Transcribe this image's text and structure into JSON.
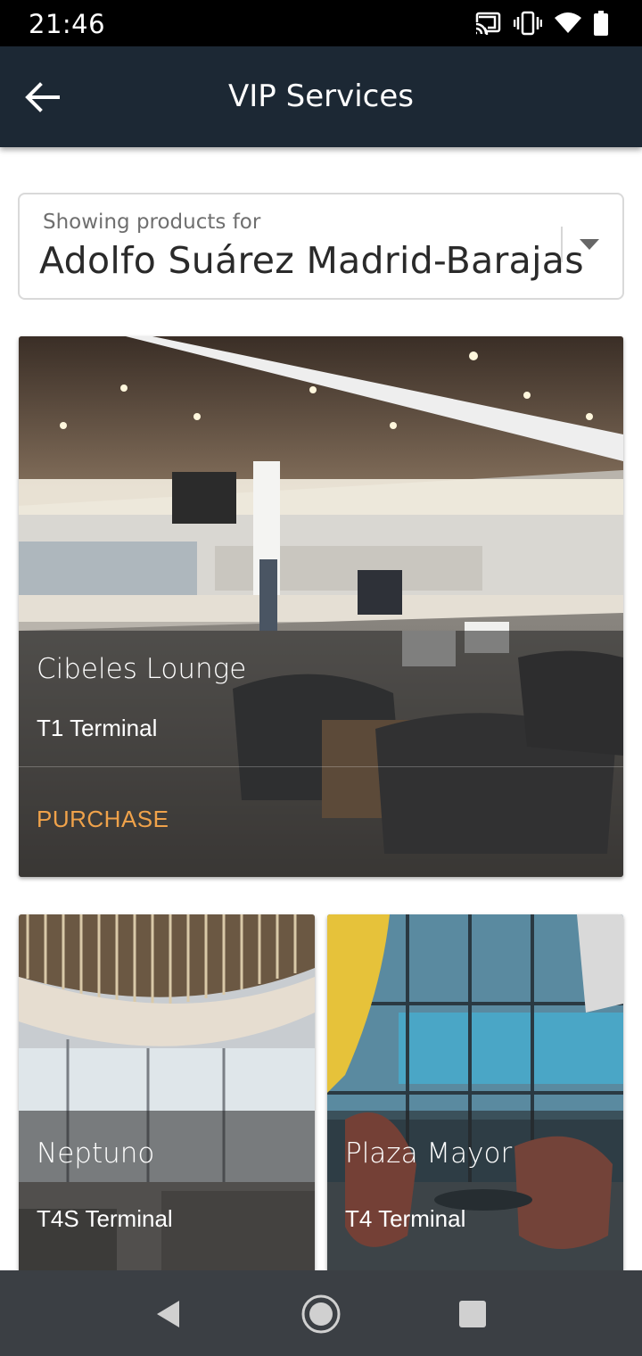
{
  "status_bar": {
    "time": "21:46",
    "icons": [
      "cast-icon",
      "vibrate-icon",
      "wifi-icon",
      "battery-icon"
    ]
  },
  "app_bar": {
    "title": "VIP Services",
    "back_icon": "arrow-left-icon"
  },
  "airport_selector": {
    "label": "Showing products for",
    "value": "Adolfo Suárez Madrid-Barajas"
  },
  "products": [
    {
      "name": "Cibeles Lounge",
      "terminal": "T1 Terminal",
      "action": "PURCHASE"
    },
    {
      "name": "Neptuno",
      "terminal": "T4S Terminal"
    },
    {
      "name": "Plaza Mayor",
      "terminal": "T4 Terminal"
    }
  ],
  "colors": {
    "app_bar": "#1c2834",
    "accent": "#f0a24a",
    "nav_bar": "#3b3f44"
  },
  "nav_bar": {
    "icons": [
      "back-triangle-icon",
      "home-circle-icon",
      "recents-square-icon"
    ]
  }
}
